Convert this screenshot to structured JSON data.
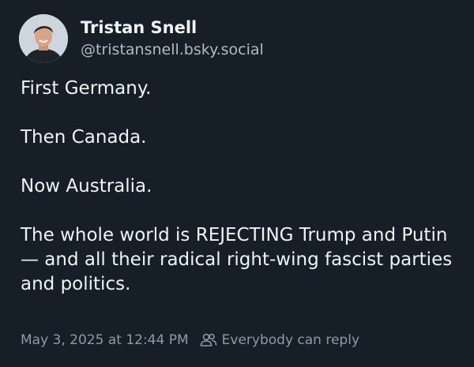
{
  "author": {
    "display_name": "Tristan Snell",
    "handle": "@tristansnell.bsky.social",
    "avatar_icon": "profile-photo"
  },
  "post": {
    "paragraphs": [
      "First Germany.",
      "Then Canada.",
      "Now Australia.",
      "The whole world is REJECTING Trump and Putin — and all their radical right-wing fascist parties and politics."
    ]
  },
  "footer": {
    "timestamp": "May 3, 2025 at 12:44 PM",
    "reply_icon": "people-icon",
    "reply_setting": "Everybody can reply"
  },
  "colors": {
    "background": "#161e27",
    "text": "#f1f3f5",
    "handle": "#aebbc9",
    "meta": "#8c9aab"
  }
}
